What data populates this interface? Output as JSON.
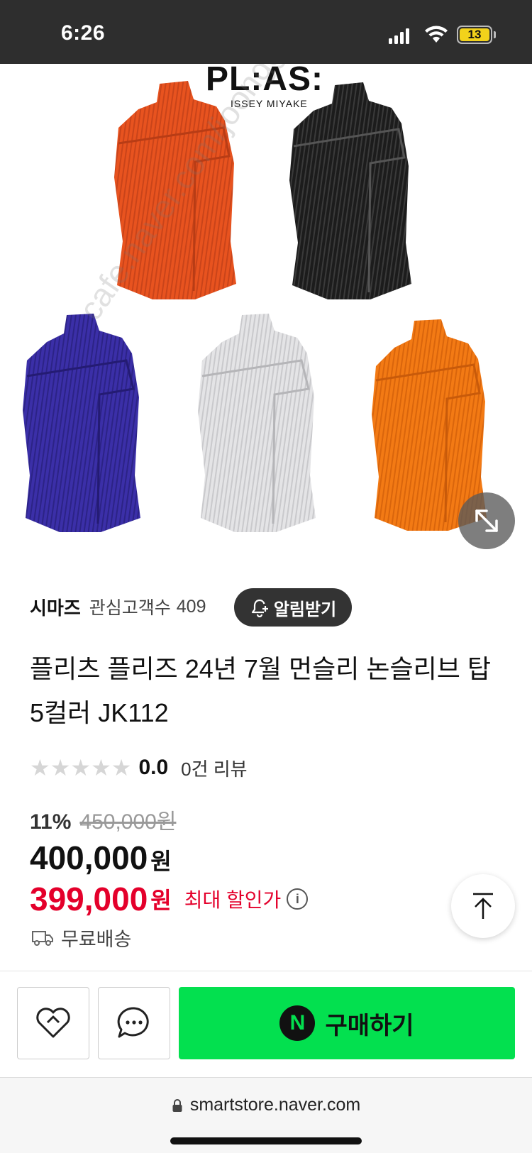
{
  "status_bar": {
    "time": "6:26",
    "battery": "13",
    "icons": [
      "signal-icon",
      "wifi-icon",
      "battery-icon"
    ]
  },
  "product_image": {
    "logo": "PL:AS:",
    "brand_sub": "ISSEY MIYAKE",
    "watermark": "cafe.naver.com/joonggonara",
    "colors": {
      "orange_top": "#e8531f",
      "black": "#1c1c1c",
      "navy": "#3b2fa8",
      "light_gray": "#e4e4e6",
      "bright_orange": "#f37a14"
    },
    "expand_icon": "expand-arrows-icon"
  },
  "seller": {
    "name": "시마즈",
    "follower_label": "관심고객수",
    "follower_count": "409",
    "notify_label": "알림받기"
  },
  "product": {
    "title": "플리츠 플리즈 24년 7월 먼슬리 논슬리브 탑 5컬러 JK112",
    "rating": "0.0",
    "stars_filled": 0,
    "stars_total": 5,
    "review_count": "0건 리뷰",
    "discount_rate": "11%",
    "original_price": "450,000원",
    "price": "400,000",
    "price_unit": "원",
    "sale_price": "399,000",
    "sale_unit": "원",
    "sale_label": "최대 할인가",
    "shipping": "무료배송"
  },
  "actions": {
    "wishlist_icon": "heart-icon",
    "chat_icon": "chat-bubble-icon",
    "buy_label": "구매하기",
    "npay_letter": "N"
  },
  "browser": {
    "url": "smartstore.naver.com"
  },
  "accent_colors": {
    "buy_green": "#03e04f",
    "sale_red": "#e4002b"
  }
}
